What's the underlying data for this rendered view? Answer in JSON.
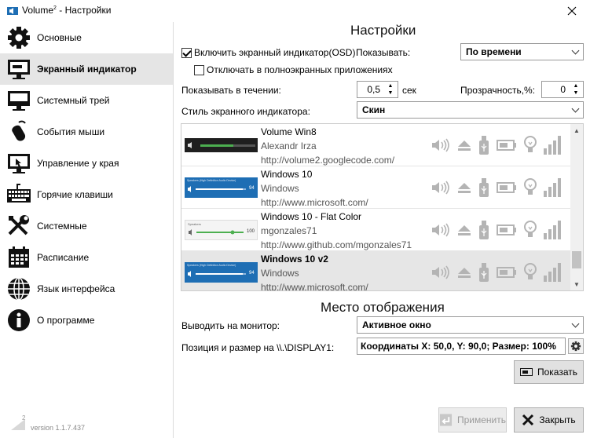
{
  "window": {
    "title": "Volume",
    "title_sup": "2",
    "title_rest": " - Настройки"
  },
  "sidebar": {
    "items": [
      {
        "label": "Основные",
        "icon": "gear-icon"
      },
      {
        "label": "Экранный индикатор",
        "icon": "monitor-icon"
      },
      {
        "label": "Системный трей",
        "icon": "tray-icon"
      },
      {
        "label": "События мыши",
        "icon": "mouse-icon"
      },
      {
        "label": "Управление у края",
        "icon": "screen-edge-icon"
      },
      {
        "label": "Горячие клавиши",
        "icon": "keyboard-icon"
      },
      {
        "label": "Системные",
        "icon": "tools-icon"
      },
      {
        "label": "Расписание",
        "icon": "calendar-icon"
      },
      {
        "label": "Язык интерфейса",
        "icon": "globe-icon"
      },
      {
        "label": "О программе",
        "icon": "info-icon"
      }
    ],
    "active_index": 1,
    "version": "version 1.1.7.437",
    "logo_text": "2"
  },
  "settings": {
    "title": "Настройки",
    "enable_osd_label": "Включить экранный индикатор(OSD)",
    "enable_osd_checked": true,
    "show_label": "Показывать:",
    "show_value": "По времени",
    "disable_fullscreen_label": "Отключать в полноэкранных приложениях",
    "disable_fullscreen_checked": false,
    "duration_label": "Показывать в течении:",
    "duration_value": "0,5",
    "duration_unit": "сек",
    "transparency_label": "Прозрачность,%:",
    "transparency_value": "0",
    "style_label": "Стиль экранного индикатора:",
    "style_value": "Скин"
  },
  "skins": [
    {
      "name": "Volume Win8",
      "author": "Alexandr Irza",
      "url": "http://volume2.googlecode.com/",
      "preview": "dark",
      "preview_text": ""
    },
    {
      "name": "Windows 10",
      "author": "Windows",
      "url": "http://www.microsoft.com/",
      "preview": "blue",
      "preview_text": "Speakers (High Definition Audio Device)",
      "preview_value": "94"
    },
    {
      "name": "Windows 10 - Flat Color",
      "author": "mgonzales71",
      "url": "http://www.github.com/mgonzales71",
      "preview": "light",
      "preview_text": "Speakers",
      "preview_value": "100"
    },
    {
      "name": "Windows 10 v2",
      "author": "Windows",
      "url": "http://www.microsoft.com/",
      "preview": "blue",
      "preview_text": "Speakers (High Definition Audio Device)",
      "preview_value": "94"
    }
  ],
  "skins_selected_index": 3,
  "location": {
    "title": "Место отображения",
    "monitor_label": "Выводить на монитор:",
    "monitor_value": "Активное окно",
    "position_label": "Позиция и размер на \\\\.\\DISPLAY1:",
    "position_value": "Координаты X: 50,0, Y: 90,0; Размер: 100%",
    "show_button": "Показать"
  },
  "footer": {
    "apply_button": "Применить",
    "close_button": "Закрыть"
  },
  "colors": {
    "accent_blue": "#1e6eb4",
    "icon_gray": "#b4b4b4",
    "selected_bg": "#e6e6e6"
  }
}
